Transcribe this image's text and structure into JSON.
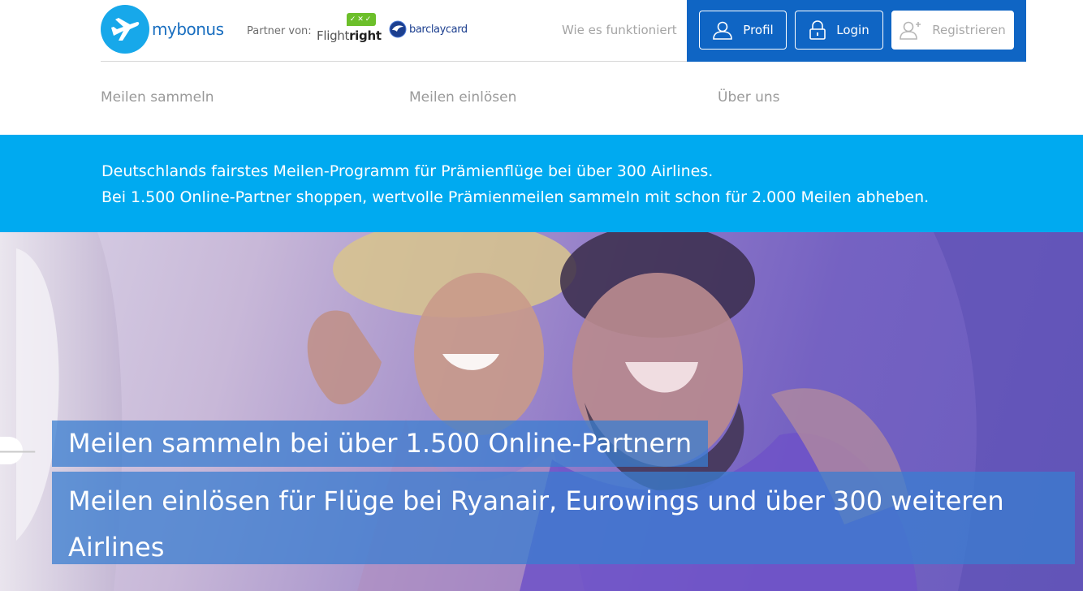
{
  "header": {
    "logo_text": "mybonus",
    "partner_label": "Partner von:",
    "flightright": {
      "light": "Flight",
      "bold": "right",
      "checks": "✓✕✓"
    },
    "barclaycard": "barclaycard",
    "how_it_works": "Wie es funktioniert",
    "auth": {
      "profile": "Profil",
      "login": "Login",
      "register": "Registrieren"
    }
  },
  "nav": {
    "items": [
      "Meilen sammeln",
      "Meilen einlösen",
      "Über uns"
    ]
  },
  "banner": {
    "line1": "Deutschlands fairstes Meilen-Programm für Prämienflüge bei über 300 Airlines.",
    "line2": "Bei 1.500 Online-Partner shoppen, wertvolle Prämienmeilen sammeln mit schon für 2.000 Meilen abheben."
  },
  "hero": {
    "caption1": "Meilen sammeln bei über 1.500 Online-Partnern",
    "caption2": "Meilen einlösen für Flüge bei Ryanair, Eurowings und über 300 weiteren Airlines",
    "prev_arrow": "🡐"
  },
  "colors": {
    "brand_blue": "#0f65c4",
    "banner_cyan": "#00aaf0",
    "logo_blue": "#17a8ea",
    "flightright_green": "#6cbf2a"
  },
  "icons": {
    "logo": "airplane-icon",
    "profile": "user-icon",
    "login": "lock-icon",
    "register": "add-user-icon",
    "prev": "arrow-left-icon"
  }
}
